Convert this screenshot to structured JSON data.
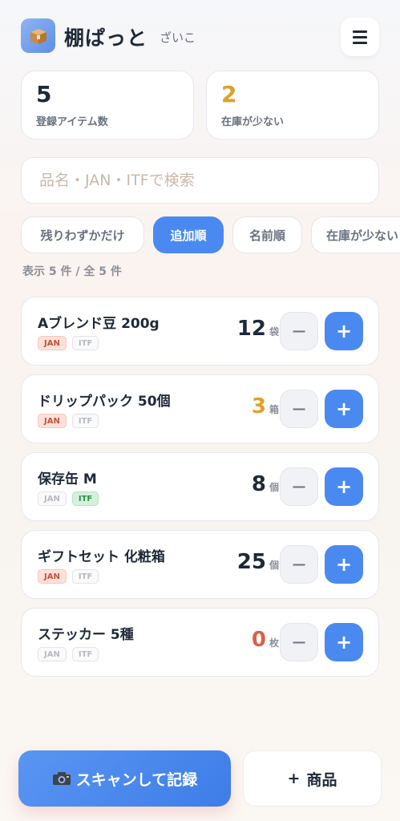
{
  "header": {
    "title": "棚ぱっと",
    "subtitle": "ざいこ",
    "logo_icon": "box-icon",
    "menu_icon": "hamburger-icon"
  },
  "stats": [
    {
      "value": "5",
      "label": "登録アイテム数",
      "color": "#1f2937"
    },
    {
      "value": "2",
      "label": "在庫が少ない",
      "color": "#e0a024"
    }
  ],
  "search": {
    "placeholder": "品名・JAN・ITFで検索",
    "value": ""
  },
  "filters": [
    {
      "label": "残りわずかだけ",
      "active": false
    },
    {
      "label": "追加順",
      "active": true
    },
    {
      "label": "名前順",
      "active": false
    },
    {
      "label": "在庫が少ない",
      "active": false
    }
  ],
  "count_text": "表示 5 件 / 全 5 件",
  "items": [
    {
      "name": "Aブレンド豆 200g",
      "qty": "12",
      "unit": "袋",
      "qty_color": "#1f2937",
      "jan": true,
      "itf": false
    },
    {
      "name": "ドリップパック 50個",
      "qty": "3",
      "unit": "箱",
      "qty_color": "#e0a024",
      "jan": true,
      "itf": false
    },
    {
      "name": "保存缶 M",
      "qty": "8",
      "unit": "個",
      "qty_color": "#1f2937",
      "jan": false,
      "itf": true
    },
    {
      "name": "ギフトセット 化粧箱",
      "qty": "25",
      "unit": "個",
      "qty_color": "#1f2937",
      "jan": true,
      "itf": false
    },
    {
      "name": "ステッカー 5種",
      "qty": "0",
      "unit": "枚",
      "qty_color": "#d9604a",
      "jan": false,
      "itf": false
    }
  ],
  "tag_labels": {
    "jan": "JAN",
    "itf": "ITF"
  },
  "buttons": {
    "minus": "−",
    "plus": "+"
  },
  "bottom": {
    "scan_label": "スキャンして記録",
    "scan_icon": "camera-icon",
    "add_label": "商品",
    "add_prefix": "+"
  },
  "colors": {
    "accent": "#4a8af0",
    "warning": "#e0a024",
    "danger": "#d9604a"
  }
}
